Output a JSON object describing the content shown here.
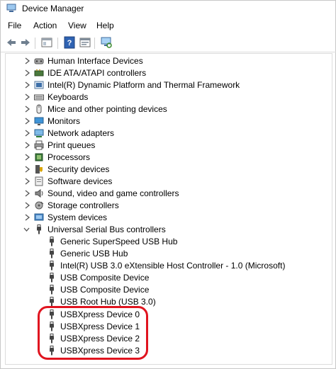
{
  "window": {
    "title": "Device Manager"
  },
  "menu": [
    "File",
    "Action",
    "View",
    "Help"
  ],
  "toolbar": {
    "buttons": [
      "back-arrow-icon",
      "forward-arrow-icon",
      "show-hide-console-tree-icon",
      "help-icon",
      "properties-icon",
      "scan-hardware-changes-icon"
    ]
  },
  "tree": {
    "categories": [
      {
        "label": "Human Interface Devices",
        "icon": "hid-icon",
        "expanded": false
      },
      {
        "label": "IDE ATA/ATAPI controllers",
        "icon": "ide-controller-icon",
        "expanded": false
      },
      {
        "label": "Intel(R) Dynamic Platform and Thermal Framework",
        "icon": "thermal-framework-icon",
        "expanded": false
      },
      {
        "label": "Keyboards",
        "icon": "keyboard-icon",
        "expanded": false
      },
      {
        "label": "Mice and other pointing devices",
        "icon": "mouse-icon",
        "expanded": false
      },
      {
        "label": "Monitors",
        "icon": "monitor-icon",
        "expanded": false
      },
      {
        "label": "Network adapters",
        "icon": "network-adapter-icon",
        "expanded": false
      },
      {
        "label": "Print queues",
        "icon": "printer-icon",
        "expanded": false
      },
      {
        "label": "Processors",
        "icon": "processor-icon",
        "expanded": false
      },
      {
        "label": "Security devices",
        "icon": "security-device-icon",
        "expanded": false
      },
      {
        "label": "Software devices",
        "icon": "software-device-icon",
        "expanded": false
      },
      {
        "label": "Sound, video and game controllers",
        "icon": "speaker-icon",
        "expanded": false
      },
      {
        "label": "Storage controllers",
        "icon": "storage-controller-icon",
        "expanded": false
      },
      {
        "label": "System devices",
        "icon": "system-device-icon",
        "expanded": false
      },
      {
        "label": "Universal Serial Bus controllers",
        "icon": "usb-icon",
        "expanded": true
      }
    ],
    "usb_children": [
      "Generic SuperSpeed USB Hub",
      "Generic USB Hub",
      "Intel(R) USB 3.0 eXtensible Host Controller - 1.0 (Microsoft)",
      "USB Composite Device",
      "USB Composite Device",
      "USB Root Hub (USB 3.0)",
      "USBXpress Device 0",
      "USBXpress Device 1",
      "USBXpress Device 2",
      "USBXpress Device 3"
    ]
  },
  "colors": {
    "highlight": "#e0141f",
    "accent": "#1e6fbf"
  }
}
